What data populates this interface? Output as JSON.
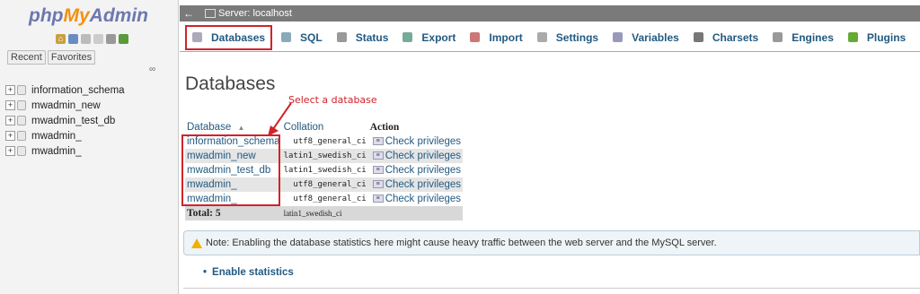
{
  "logo": {
    "php": "php",
    "my": "My",
    "admin": "Admin"
  },
  "sidebar": {
    "recent_label": "Recent",
    "favorites_label": "Favorites",
    "databases": [
      {
        "name": "information_schema"
      },
      {
        "name": "mwadmin_new"
      },
      {
        "name": "mwadmin_test_db"
      },
      {
        "name": "mwadmin_"
      },
      {
        "name": "mwadmin_"
      }
    ]
  },
  "topbar": {
    "server_label": "Server: localhost"
  },
  "tabs": [
    {
      "label": "Databases",
      "icon": "database-icon",
      "color": "#aab"
    },
    {
      "label": "SQL",
      "icon": "sql-icon",
      "color": "#8ab"
    },
    {
      "label": "Status",
      "icon": "status-icon",
      "color": "#999"
    },
    {
      "label": "Export",
      "icon": "export-icon",
      "color": "#7a9"
    },
    {
      "label": "Import",
      "icon": "import-icon",
      "color": "#c77"
    },
    {
      "label": "Settings",
      "icon": "wrench-icon",
      "color": "#aaa"
    },
    {
      "label": "Variables",
      "icon": "variables-icon",
      "color": "#99b"
    },
    {
      "label": "Charsets",
      "icon": "charsets-icon",
      "color": "#777"
    },
    {
      "label": "Engines",
      "icon": "engines-icon",
      "color": "#999"
    },
    {
      "label": "Plugins",
      "icon": "plugins-icon",
      "color": "#6a3"
    }
  ],
  "main": {
    "title": "Databases",
    "annotation": "Select a database",
    "table": {
      "headers": {
        "database": "Database",
        "collation": "Collation",
        "action": "Action"
      },
      "sort_indicator": "▲",
      "rows": [
        {
          "name": "information_schema",
          "collation": "utf8_general_ci",
          "action": "Check privileges"
        },
        {
          "name": "mwadmin_new",
          "collation": "latin1_swedish_ci",
          "action": "Check privileges"
        },
        {
          "name": "mwadmin_test_db",
          "collation": "latin1_swedish_ci",
          "action": "Check privileges"
        },
        {
          "name": "mwadmin_",
          "collation": "utf8_general_ci",
          "action": "Check privileges"
        },
        {
          "name": "mwadmin_",
          "collation": "utf8_general_ci",
          "action": "Check privileges"
        }
      ],
      "total_label": "Total: 5",
      "total_collation": "latin1_swedish_ci"
    },
    "notice": "Note: Enabling the database statistics here might cause heavy traffic between the web server and the MySQL server.",
    "enable_stats": "Enable statistics"
  }
}
